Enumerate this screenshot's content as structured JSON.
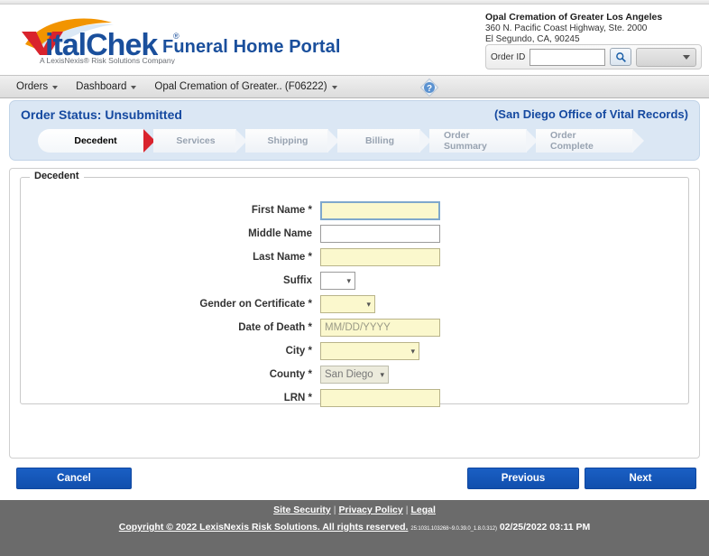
{
  "header": {
    "logo_text": "VitalChek",
    "logo_tagline": "A LexisNexis® Risk Solutions Company",
    "portal_title": "Funeral Home Portal",
    "org_name": "Opal Cremation of Greater Los Angeles",
    "org_address_1": "360 N. Pacific Coast Highway, Ste. 2000",
    "org_address_2": "El Segundo, CA, 90245",
    "order_id_label": "Order ID",
    "order_id_value": "",
    "order_id_placeholder": "",
    "org_select_value": ""
  },
  "nav": {
    "items": [
      {
        "label": "Orders",
        "has_caret": true
      },
      {
        "label": "Dashboard",
        "has_caret": true
      },
      {
        "label": "Opal Cremation of Greater.. (F06222)",
        "has_caret": true
      }
    ],
    "help_title": "?"
  },
  "status": {
    "title": "Order Status: Unsubmitted",
    "office": "(San Diego Office of Vital Records)",
    "steps": [
      {
        "label": "Decedent",
        "active": true
      },
      {
        "label": "Services",
        "active": false
      },
      {
        "label": "Shipping",
        "active": false
      },
      {
        "label": "Billing",
        "active": false
      },
      {
        "label": "Order Summary",
        "active": false
      },
      {
        "label": "Order Complete",
        "active": false
      }
    ]
  },
  "form": {
    "legend": "Decedent",
    "fields": [
      {
        "label": "First Name *",
        "type": "text",
        "value": "",
        "placeholder": "",
        "required": true,
        "focused": true
      },
      {
        "label": "Middle Name",
        "type": "text",
        "value": "",
        "placeholder": "",
        "required": false,
        "focused": false
      },
      {
        "label": "Last Name *",
        "type": "text",
        "value": "",
        "placeholder": "",
        "required": true,
        "focused": false
      },
      {
        "label": "Suffix",
        "type": "select",
        "value": "",
        "required": false,
        "disabled": false
      },
      {
        "label": "Gender on Certificate *",
        "type": "select",
        "value": "",
        "required": true,
        "disabled": false
      },
      {
        "label": "Date of Death *",
        "type": "text",
        "value": "",
        "placeholder": "MM/DD/YYYY",
        "required": true,
        "focused": false
      },
      {
        "label": "City *",
        "type": "select",
        "value": "",
        "required": true,
        "disabled": false
      },
      {
        "label": "County *",
        "type": "select",
        "value": "San Diego",
        "required": false,
        "disabled": true
      },
      {
        "label": "LRN *",
        "type": "text",
        "value": "",
        "placeholder": "",
        "required": true,
        "focused": false
      }
    ]
  },
  "actions": {
    "cancel": "Cancel",
    "previous": "Previous",
    "next": "Next"
  },
  "footer": {
    "links": [
      "Site Security",
      "Privacy Policy",
      "Legal"
    ],
    "separator": "|",
    "copyright": "Copyright ©  2022  LexisNexis Risk Solutions. All rights reserved.",
    "version": "25:1031.103268~9.0.39.0_1.8.0.312)",
    "timestamp": "02/25/2022 03:11 PM"
  },
  "colors": {
    "brand_blue": "#1a4f9c",
    "status_blue": "#1549a0",
    "panel_bg": "#dbe7f4",
    "required_field": "#fbf8cd",
    "button_blue": "#114fad",
    "active_step_arrow": "#d9232d",
    "footer_bg": "#6b6b6b"
  }
}
